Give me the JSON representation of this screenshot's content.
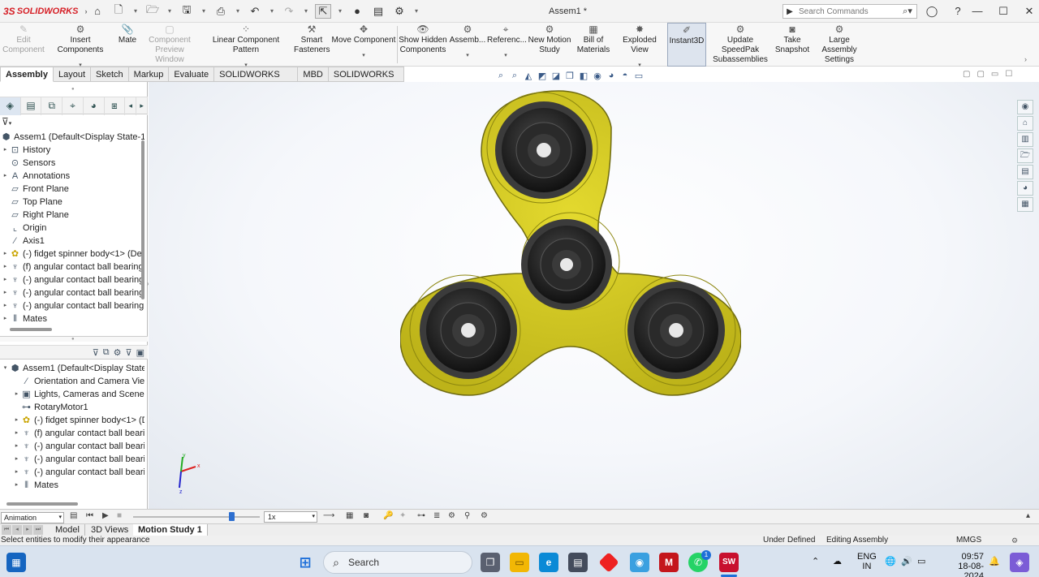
{
  "app": {
    "logo_prefix": "3S",
    "logo_text": "SOLIDWORKS",
    "document_title": "Assem1 *"
  },
  "search": {
    "placeholder": "Search Commands"
  },
  "command_manager": {
    "commands": [
      {
        "id": "edit-component",
        "line1": "Edit",
        "line2": "Component",
        "enabled": false
      },
      {
        "id": "insert-components",
        "line1": "Insert Components",
        "line2": "",
        "enabled": true
      },
      {
        "id": "mate",
        "line1": "Mate",
        "line2": "",
        "enabled": true
      },
      {
        "id": "component-preview-window",
        "line1": "Component",
        "line2": "Preview Window",
        "enabled": false
      },
      {
        "id": "linear-component-pattern",
        "line1": "Linear Component Pattern",
        "line2": "",
        "enabled": true
      },
      {
        "id": "smart-fasteners",
        "line1": "Smart",
        "line2": "Fasteners",
        "enabled": true
      },
      {
        "id": "move-component",
        "line1": "Move Component",
        "line2": "",
        "enabled": true
      },
      {
        "id": "show-hidden-components",
        "line1": "Show Hidden",
        "line2": "Components",
        "enabled": true
      },
      {
        "id": "assembly-features",
        "line1": "Assemb...",
        "line2": "",
        "enabled": true
      },
      {
        "id": "reference-geometry",
        "line1": "Referenc...",
        "line2": "",
        "enabled": true
      },
      {
        "id": "new-motion-study",
        "line1": "New Motion",
        "line2": "Study",
        "enabled": true
      },
      {
        "id": "bill-of-materials",
        "line1": "Bill of",
        "line2": "Materials",
        "enabled": true
      },
      {
        "id": "exploded-view",
        "line1": "Exploded View",
        "line2": "",
        "enabled": true
      },
      {
        "id": "instant3d",
        "line1": "Instant3D",
        "line2": "",
        "enabled": true
      },
      {
        "id": "update-speedpak",
        "line1": "Update SpeedPak",
        "line2": "Subassemblies",
        "enabled": true
      },
      {
        "id": "take-snapshot",
        "line1": "Take",
        "line2": "Snapshot",
        "enabled": true
      },
      {
        "id": "large-assembly-settings",
        "line1": "Large Assembly",
        "line2": "Settings",
        "enabled": true
      }
    ],
    "tabs": [
      "Assembly",
      "Layout",
      "Sketch",
      "Markup",
      "Evaluate",
      "SOLIDWORKS Add-Ins",
      "MBD",
      "SOLIDWORKS CAM"
    ],
    "active_tab": "Assembly"
  },
  "feature_tree": {
    "root": "Assem1  (Default<Display State-1>",
    "items": [
      {
        "label": "History",
        "icon": "history-icon"
      },
      {
        "label": "Sensors",
        "icon": "sensors-icon"
      },
      {
        "label": "Annotations",
        "icon": "annotations-icon"
      },
      {
        "label": "Front Plane",
        "icon": "plane-icon"
      },
      {
        "label": "Top Plane",
        "icon": "plane-icon"
      },
      {
        "label": "Right Plane",
        "icon": "plane-icon"
      },
      {
        "label": "Origin",
        "icon": "origin-icon"
      },
      {
        "label": "Axis1",
        "icon": "axis-icon"
      },
      {
        "label": "(-) fidget spinner body<1> (Default",
        "icon": "part-icon"
      },
      {
        "label": "(f) angular contact ball bearing",
        "icon": "subassembly-icon"
      },
      {
        "label": "(-) angular contact ball bearing",
        "icon": "subassembly-icon"
      },
      {
        "label": "(-) angular contact ball bearing",
        "icon": "subassembly-icon"
      },
      {
        "label": "(-) angular contact ball bearing",
        "icon": "subassembly-icon"
      },
      {
        "label": "Mates",
        "icon": "mates-icon"
      }
    ]
  },
  "motion_tree": {
    "root": "Assem1  (Default<Display State-1>",
    "items": [
      {
        "label": "Orientation and Camera Views",
        "icon": "camera-icon"
      },
      {
        "label": "Lights, Cameras and Scene",
        "icon": "lights-icon"
      },
      {
        "label": "RotaryMotor1",
        "icon": "motor-icon"
      },
      {
        "label": "(-) fidget spinner body<1> (Default",
        "icon": "part-icon"
      },
      {
        "label": "(f) angular contact ball bearing",
        "icon": "subassembly-icon"
      },
      {
        "label": "(-) angular contact ball bearing",
        "icon": "subassembly-icon"
      },
      {
        "label": "(-) angular contact ball bearing",
        "icon": "subassembly-icon"
      },
      {
        "label": "(-) angular contact ball bearing",
        "icon": "subassembly-icon"
      },
      {
        "label": "Mates",
        "icon": "mates-icon"
      }
    ]
  },
  "motion_study": {
    "study_type": "Animation",
    "playback_speed": "1x",
    "timeline_position": 0.78
  },
  "triad": {
    "x_label": "x",
    "y_label": "y",
    "z_label": "z"
  },
  "bottom_tabs": [
    "Model",
    "3D Views",
    "Motion Study 1"
  ],
  "active_bottom_tab": "Motion Study 1",
  "status_bar": {
    "message": "Select entities to modify their appearance",
    "definition": "Under Defined",
    "mode": "Editing Assembly",
    "units": "MMGS"
  },
  "taskbar": {
    "search_label": "Search",
    "lang_line1": "ENG",
    "lang_line2": "IN",
    "time": "09:57",
    "date": "18-08-2024",
    "whatsapp_badge": "1",
    "sw_label": "SW"
  },
  "colors": {
    "spinner_body": "#d9cf1e",
    "bearing": "#1c1c1c",
    "accent": "#2d6fd0",
    "brand": "#d62027"
  }
}
